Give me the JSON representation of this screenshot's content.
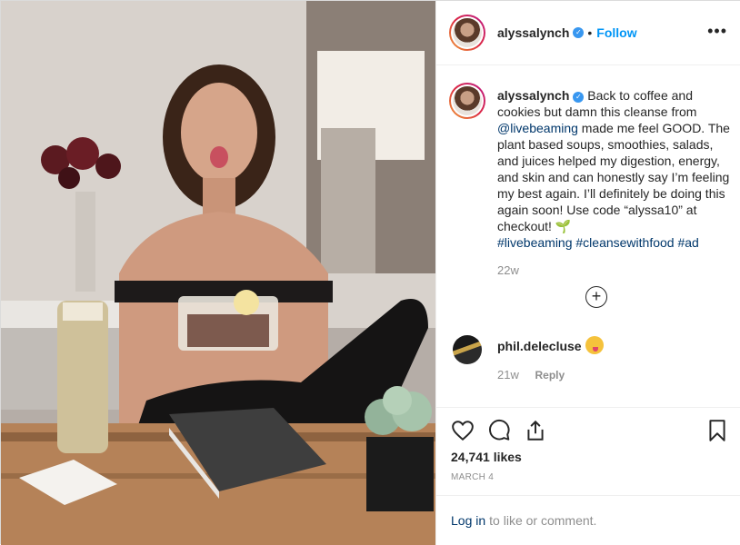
{
  "post": {
    "username": "alyssalynch",
    "separator": "•",
    "follow_label": "Follow",
    "more_label": "•••",
    "caption": {
      "username": "alyssalynch",
      "text_part1": "Back to coffee and cookies but damn this cleanse from ",
      "mention": "@livebeaming",
      "text_part2": " made me feel GOOD. The plant based soups, smoothies, salads, and juices helped my digestion, energy, and skin and can honestly say I’m feeling my best again. I’ll definitely be doing this again soon! Use code “alyssa10” at checkout! 🌱",
      "hashtags": [
        "#livebeaming",
        "#cleansewithfood",
        "#ad"
      ]
    },
    "caption_age": "22w",
    "load_more_label": "+",
    "comment": {
      "username": "phil.delecluse",
      "age": "21w",
      "reply_label": "Reply"
    },
    "likes": "24,741 likes",
    "date": "MARCH 4",
    "login_link": "Log in",
    "login_text": "to like or comment."
  },
  "icons": {
    "heart": "heart-icon",
    "comment": "comment-icon",
    "share": "share-icon",
    "save": "bookmark-icon",
    "verified": "verified-badge-icon"
  },
  "colors": {
    "link": "#00376b",
    "follow": "#0095f6",
    "muted": "#8e8e8e",
    "verified": "#3897f0"
  }
}
